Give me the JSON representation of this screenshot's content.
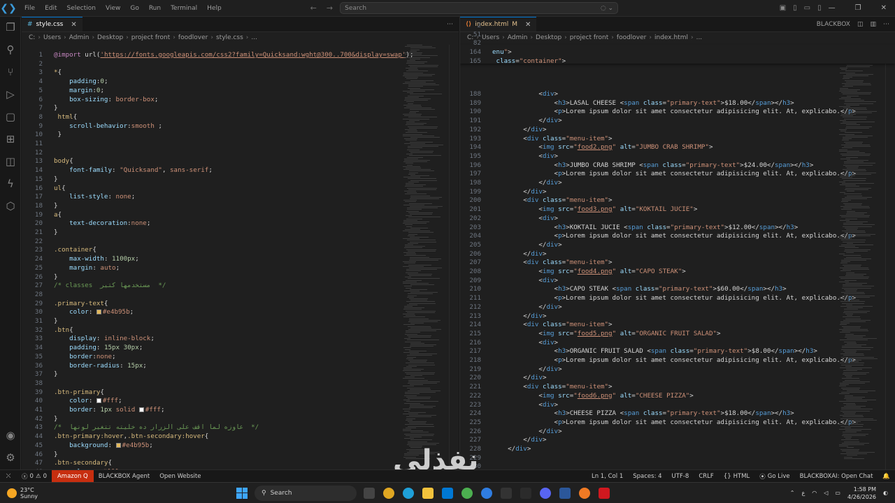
{
  "titlebar": {
    "menu": [
      "File",
      "Edit",
      "Selection",
      "View",
      "Go",
      "Run",
      "Terminal",
      "Help"
    ],
    "search_placeholder": "Search"
  },
  "left_editor": {
    "tab_label": "style.css",
    "breadcrumb": [
      "C:",
      "Users",
      "Admin",
      "Desktop",
      "project front",
      "foodlover",
      "style.css",
      "..."
    ],
    "lines": [
      {
        "n": "1",
        "html": "<span class='at'>@import</span> <span class='pu'>url(</span><span class='u'>'https://fonts.googleapis.com/css2?family=Quicksand:wght@300..700&display=swap'</span><span class='pu'>);</span>"
      },
      {
        "n": "2",
        "html": ""
      },
      {
        "n": "3",
        "html": "<span class='k'>*</span><span class='pu'>{</span>"
      },
      {
        "n": "4",
        "html": "    <span class='p'>padding</span><span class='pu'>:</span><span class='n'>0</span><span class='pu'>;</span>"
      },
      {
        "n": "5",
        "html": "    <span class='p'>margin</span><span class='pu'>:</span><span class='n'>0</span><span class='pu'>;</span>"
      },
      {
        "n": "6",
        "html": "    <span class='p'>box-sizing</span><span class='pu'>: </span><span class='v'>border-box</span><span class='pu'>;</span>"
      },
      {
        "n": "7",
        "html": "<span class='pu'>}</span>"
      },
      {
        "n": "8",
        "html": " <span class='k'>html</span><span class='pu'>{</span>"
      },
      {
        "n": "9",
        "html": "    <span class='p'>scroll-behavior</span><span class='pu'>:</span><span class='v'>smooth</span> <span class='pu'>;</span>"
      },
      {
        "n": "10",
        "html": " <span class='pu'>}</span>"
      },
      {
        "n": "11",
        "html": ""
      },
      {
        "n": "12",
        "html": ""
      },
      {
        "n": "13",
        "html": "<span class='k'>body</span><span class='pu'>{</span>"
      },
      {
        "n": "14",
        "html": "    <span class='p'>font-family</span><span class='pu'>: </span><span class='s'>\"Quicksand\"</span><span class='pu'>, </span><span class='v'>sans-serif</span><span class='pu'>;</span>"
      },
      {
        "n": "15",
        "html": "<span class='pu'>}</span>"
      },
      {
        "n": "16",
        "html": "<span class='k'>ul</span><span class='pu'>{</span>"
      },
      {
        "n": "17",
        "html": "    <span class='p'>list-style</span><span class='pu'>: </span><span class='v'>none</span><span class='pu'>;</span>"
      },
      {
        "n": "18",
        "html": "<span class='pu'>}</span>"
      },
      {
        "n": "19",
        "html": "<span class='k'>a</span><span class='pu'>{</span>"
      },
      {
        "n": "20",
        "html": "    <span class='p'>text-decoration</span><span class='pu'>:</span><span class='v'>none</span><span class='pu'>;</span>"
      },
      {
        "n": "21",
        "html": "<span class='pu'>}</span>"
      },
      {
        "n": "22",
        "html": ""
      },
      {
        "n": "23",
        "html": "<span class='k'>.container</span><span class='pu'>{</span>"
      },
      {
        "n": "24",
        "html": "    <span class='p'>max-width</span><span class='pu'>: </span><span class='n'>1100px</span><span class='pu'>;</span>"
      },
      {
        "n": "25",
        "html": "    <span class='p'>margin</span><span class='pu'>: </span><span class='v'>auto</span><span class='pu'>;</span>"
      },
      {
        "n": "26",
        "html": "<span class='pu'>}</span>"
      },
      {
        "n": "27",
        "html": "<span class='c'>/* classes  مستخدمها كتير  */</span>"
      },
      {
        "n": "28",
        "html": ""
      },
      {
        "n": "29",
        "html": "<span class='k'>.primary-text</span><span class='pu'>{</span>"
      },
      {
        "n": "30",
        "html": "    <span class='p'>color</span><span class='pu'>: </span><span class='sw' style='background:#e4b95b'></span><span class='v'>#e4b95b</span><span class='pu'>;</span>"
      },
      {
        "n": "31",
        "html": "<span class='pu'>}</span>"
      },
      {
        "n": "32",
        "html": "<span class='k'>.btn</span><span class='pu'>{</span>"
      },
      {
        "n": "33",
        "html": "    <span class='p'>display</span><span class='pu'>: </span><span class='v'>inline-block</span><span class='pu'>;</span>"
      },
      {
        "n": "34",
        "html": "    <span class='p'>padding</span><span class='pu'>: </span><span class='n'>15px 30px</span><span class='pu'>;</span>"
      },
      {
        "n": "35",
        "html": "    <span class='p'>border</span><span class='pu'>:</span><span class='v'>none</span><span class='pu'>;</span>"
      },
      {
        "n": "36",
        "html": "    <span class='p'>border-radius</span><span class='pu'>: </span><span class='n'>15px</span><span class='pu'>;</span>"
      },
      {
        "n": "37",
        "html": "<span class='pu'>}</span>"
      },
      {
        "n": "38",
        "html": ""
      },
      {
        "n": "39",
        "html": "<span class='k'>.btn-primary</span><span class='pu'>{</span>"
      },
      {
        "n": "40",
        "html": "    <span class='p'>color</span><span class='pu'>: </span><span class='sw' style='background:#ffffff'></span><span class='v'>#fff</span><span class='pu'>;</span>"
      },
      {
        "n": "41",
        "html": "    <span class='p'>border</span><span class='pu'>: </span><span class='n'>1px</span> <span class='v'>solid</span> <span class='sw' style='background:#ffffff'></span><span class='v'>#fff</span><span class='pu'>;</span>"
      },
      {
        "n": "42",
        "html": "<span class='pu'>}</span>"
      },
      {
        "n": "43",
        "html": "<span class='c'>/*  عاوزه لما اقف على الزرار ده خليته تتغير لونها  */</span>"
      },
      {
        "n": "44",
        "html": "<span class='k'>.btn-primary:hover</span><span class='pu'>,</span><span class='k'>.btn-secondary:hover</span><span class='pu'>{</span>"
      },
      {
        "n": "45",
        "html": "    <span class='p'>background</span><span class='pu'>: </span><span class='sw' style='background:#e4b95b'></span><span class='v'>#e4b95b</span><span class='pu'>;</span>"
      },
      {
        "n": "46",
        "html": "<span class='pu'>}</span>"
      },
      {
        "n": "47",
        "html": "<span class='k'>.btn-secondary</span><span class='pu'>{</span>"
      },
      {
        "n": "48",
        "html": "    <span class='p'>color</span><span class='pu'>: </span><span class='sw' style='background:#ffffff'></span><span class='v'>#fff</span><span class='pu'>;</span>"
      }
    ]
  },
  "right_editor": {
    "tab_label": "index.html",
    "tab_status": "M",
    "panel_label": "BLACKBOX",
    "breadcrumb": [
      "C:",
      "Users",
      "Admin",
      "Desktop",
      "project front",
      "foodlover",
      "index.html",
      "..."
    ],
    "sticky_lines": [
      {
        "n": "2",
        "html": ""
      },
      {
        "n": "51",
        "html": ""
      },
      {
        "n": "82",
        "html": ""
      },
      {
        "n": "164",
        "html": "<span class='a'>enu</span><span class='s'>\"</span><span class='pu'>&gt;</span>"
      },
      {
        "n": "165",
        "html": "<span class='a'> class</span><span class='pu'>=</span><span class='s'>\"container\"</span><span class='pu'>&gt;</span>"
      }
    ],
    "lines": [
      {
        "n": "188",
        "html": "            <span class='pu'>&lt;</span><span class='t'>div</span><span class='pu'>&gt;</span>"
      },
      {
        "n": "189",
        "html": "                <span class='pu'>&lt;</span><span class='t'>h3</span><span class='pu'>&gt;</span>LASAL CHEESE <span class='pu'>&lt;</span><span class='t'>span</span> <span class='a'>class</span><span class='pu'>=</span><span class='s'>\"primary-text\"</span><span class='pu'>&gt;</span>$18.00<span class='pu'>&lt;/</span><span class='t'>span</span><span class='pu'>&gt;&lt;/</span><span class='t'>h3</span><span class='pu'>&gt;</span>"
      },
      {
        "n": "190",
        "html": "                <span class='pu'>&lt;</span><span class='t'>p</span><span class='pu'>&gt;</span>Lorem ipsum dolor sit amet consectetur adipisicing elit. At, explicabo.<span class='pu'>&lt;/</span><span class='t'>p</span><span class='pu'>&gt;</span>"
      },
      {
        "n": "191",
        "html": "            <span class='pu'>&lt;/</span><span class='t'>div</span><span class='pu'>&gt;</span>"
      },
      {
        "n": "192",
        "html": "        <span class='pu'>&lt;/</span><span class='t'>div</span><span class='pu'>&gt;</span>"
      },
      {
        "n": "193",
        "html": "        <span class='pu'>&lt;</span><span class='t'>div</span> <span class='a'>class</span><span class='pu'>=</span><span class='s'>\"menu-item\"</span><span class='pu'>&gt;</span>"
      },
      {
        "n": "194",
        "html": "            <span class='pu'>&lt;</span><span class='t'>img</span> <span class='a'>src</span><span class='pu'>=</span><span class='s'>\"<u>food2.png</u>\"</span> <span class='a'>alt</span><span class='pu'>=</span><span class='s'>\"JUMBO CRAB SHRIMP\"</span><span class='pu'>&gt;</span>"
      },
      {
        "n": "195",
        "html": "            <span class='pu'>&lt;</span><span class='t'>div</span><span class='pu'>&gt;</span>"
      },
      {
        "n": "196",
        "html": "                <span class='pu'>&lt;</span><span class='t'>h3</span><span class='pu'>&gt;</span>JUMBO CRAB SHRIMP <span class='pu'>&lt;</span><span class='t'>span</span> <span class='a'>class</span><span class='pu'>=</span><span class='s'>\"primary-text\"</span><span class='pu'>&gt;</span>$24.00<span class='pu'>&lt;/</span><span class='t'>span</span><span class='pu'>&gt;&lt;/</span><span class='t'>h3</span><span class='pu'>&gt;</span>"
      },
      {
        "n": "197",
        "html": "                <span class='pu'>&lt;</span><span class='t'>p</span><span class='pu'>&gt;</span>Lorem ipsum dolor sit amet consectetur adipisicing elit. At, explicabo.<span class='pu'>&lt;/</span><span class='t'>p</span><span class='pu'>&gt;</span>"
      },
      {
        "n": "198",
        "html": "            <span class='pu'>&lt;/</span><span class='t'>div</span><span class='pu'>&gt;</span>"
      },
      {
        "n": "199",
        "html": "        <span class='pu'>&lt;/</span><span class='t'>div</span><span class='pu'>&gt;</span>"
      },
      {
        "n": "200",
        "html": "        <span class='pu'>&lt;</span><span class='t'>div</span> <span class='a'>class</span><span class='pu'>=</span><span class='s'>\"menu-item\"</span><span class='pu'>&gt;</span>"
      },
      {
        "n": "201",
        "html": "            <span class='pu'>&lt;</span><span class='t'>img</span> <span class='a'>src</span><span class='pu'>=</span><span class='s'>\"<u>food3.png</u>\"</span> <span class='a'>alt</span><span class='pu'>=</span><span class='s'>\"KOKTAIL JUCIE\"</span><span class='pu'>&gt;</span>"
      },
      {
        "n": "202",
        "html": "            <span class='pu'>&lt;</span><span class='t'>div</span><span class='pu'>&gt;</span>"
      },
      {
        "n": "203",
        "html": "                <span class='pu'>&lt;</span><span class='t'>h3</span><span class='pu'>&gt;</span>KOKTAIL JUCIE <span class='pu'>&lt;</span><span class='t'>span</span> <span class='a'>class</span><span class='pu'>=</span><span class='s'>\"primary-text\"</span><span class='pu'>&gt;</span>$12.00<span class='pu'>&lt;/</span><span class='t'>span</span><span class='pu'>&gt;&lt;/</span><span class='t'>h3</span><span class='pu'>&gt;</span>"
      },
      {
        "n": "204",
        "html": "                <span class='pu'>&lt;</span><span class='t'>p</span><span class='pu'>&gt;</span>Lorem ipsum dolor sit amet consectetur adipisicing elit. At, explicabo.<span class='pu'>&lt;/</span><span class='t'>p</span><span class='pu'>&gt;</span>"
      },
      {
        "n": "205",
        "html": "            <span class='pu'>&lt;/</span><span class='t'>div</span><span class='pu'>&gt;</span>"
      },
      {
        "n": "206",
        "html": "        <span class='pu'>&lt;/</span><span class='t'>div</span><span class='pu'>&gt;</span>"
      },
      {
        "n": "207",
        "html": "        <span class='pu'>&lt;</span><span class='t'>div</span> <span class='a'>class</span><span class='pu'>=</span><span class='s'>\"menu-item\"</span><span class='pu'>&gt;</span>"
      },
      {
        "n": "208",
        "html": "            <span class='pu'>&lt;</span><span class='t'>img</span> <span class='a'>src</span><span class='pu'>=</span><span class='s'>\"<u>food4.png</u>\"</span> <span class='a'>alt</span><span class='pu'>=</span><span class='s'>\"CAPO STEAK\"</span><span class='pu'>&gt;</span>"
      },
      {
        "n": "209",
        "html": "            <span class='pu'>&lt;</span><span class='t'>div</span><span class='pu'>&gt;</span>"
      },
      {
        "n": "210",
        "html": "                <span class='pu'>&lt;</span><span class='t'>h3</span><span class='pu'>&gt;</span>CAPO STEAK <span class='pu'>&lt;</span><span class='t'>span</span> <span class='a'>class</span><span class='pu'>=</span><span class='s'>\"primary-text\"</span><span class='pu'>&gt;</span>$60.00<span class='pu'>&lt;/</span><span class='t'>span</span><span class='pu'>&gt;&lt;/</span><span class='t'>h3</span><span class='pu'>&gt;</span>"
      },
      {
        "n": "211",
        "html": "                <span class='pu'>&lt;</span><span class='t'>p</span><span class='pu'>&gt;</span>Lorem ipsum dolor sit amet consectetur adipisicing elit. At, explicabo.<span class='pu'>&lt;/</span><span class='t'>p</span><span class='pu'>&gt;</span>"
      },
      {
        "n": "212",
        "html": "            <span class='pu'>&lt;/</span><span class='t'>div</span><span class='pu'>&gt;</span>"
      },
      {
        "n": "213",
        "html": "        <span class='pu'>&lt;/</span><span class='t'>div</span><span class='pu'>&gt;</span>"
      },
      {
        "n": "214",
        "html": "        <span class='pu'>&lt;</span><span class='t'>div</span> <span class='a'>class</span><span class='pu'>=</span><span class='s'>\"menu-item\"</span><span class='pu'>&gt;</span>"
      },
      {
        "n": "215",
        "html": "            <span class='pu'>&lt;</span><span class='t'>img</span> <span class='a'>src</span><span class='pu'>=</span><span class='s'>\"<u>food5.png</u>\"</span> <span class='a'>alt</span><span class='pu'>=</span><span class='s'>\"ORGANIC FRUIT SALAD\"</span><span class='pu'>&gt;</span>"
      },
      {
        "n": "216",
        "html": "            <span class='pu'>&lt;</span><span class='t'>div</span><span class='pu'>&gt;</span>"
      },
      {
        "n": "217",
        "html": "                <span class='pu'>&lt;</span><span class='t'>h3</span><span class='pu'>&gt;</span>ORGANIC FRUIT SALAD <span class='pu'>&lt;</span><span class='t'>span</span> <span class='a'>class</span><span class='pu'>=</span><span class='s'>\"primary-text\"</span><span class='pu'>&gt;</span>$8.00<span class='pu'>&lt;/</span><span class='t'>span</span><span class='pu'>&gt;&lt;/</span><span class='t'>h3</span><span class='pu'>&gt;</span>"
      },
      {
        "n": "218",
        "html": "                <span class='pu'>&lt;</span><span class='t'>p</span><span class='pu'>&gt;</span>Lorem ipsum dolor sit amet consectetur adipisicing elit. At, explicabo.<span class='pu'>&lt;/</span><span class='t'>p</span><span class='pu'>&gt;</span>"
      },
      {
        "n": "219",
        "html": "            <span class='pu'>&lt;/</span><span class='t'>div</span><span class='pu'>&gt;</span>"
      },
      {
        "n": "220",
        "html": "        <span class='pu'>&lt;/</span><span class='t'>div</span><span class='pu'>&gt;</span>"
      },
      {
        "n": "221",
        "html": "        <span class='pu'>&lt;</span><span class='t'>div</span> <span class='a'>class</span><span class='pu'>=</span><span class='s'>\"menu-item\"</span><span class='pu'>&gt;</span>"
      },
      {
        "n": "222",
        "html": "            <span class='pu'>&lt;</span><span class='t'>img</span> <span class='a'>src</span><span class='pu'>=</span><span class='s'>\"<u>food6.png</u>\"</span> <span class='a'>alt</span><span class='pu'>=</span><span class='s'>\"CHEESE PIZZA\"</span><span class='pu'>&gt;</span>"
      },
      {
        "n": "223",
        "html": "            <span class='pu'>&lt;</span><span class='t'>div</span><span class='pu'>&gt;</span>"
      },
      {
        "n": "224",
        "html": "                <span class='pu'>&lt;</span><span class='t'>h3</span><span class='pu'>&gt;</span>CHEESE PIZZA <span class='pu'>&lt;</span><span class='t'>span</span> <span class='a'>class</span><span class='pu'>=</span><span class='s'>\"primary-text\"</span><span class='pu'>&gt;</span>$18.00<span class='pu'>&lt;/</span><span class='t'>span</span><span class='pu'>&gt;&lt;/</span><span class='t'>h3</span><span class='pu'>&gt;</span>"
      },
      {
        "n": "225",
        "html": "                <span class='pu'>&lt;</span><span class='t'>p</span><span class='pu'>&gt;</span>Lorem ipsum dolor sit amet consectetur adipisicing elit. At, explicabo.<span class='pu'>&lt;/</span><span class='t'>p</span><span class='pu'>&gt;</span>"
      },
      {
        "n": "226",
        "html": "            <span class='pu'>&lt;/</span><span class='t'>div</span><span class='pu'>&gt;</span>"
      },
      {
        "n": "227",
        "html": "        <span class='pu'>&lt;/</span><span class='t'>div</span><span class='pu'>&gt;</span>"
      },
      {
        "n": "228",
        "html": "    <span class='pu'>&lt;/</span><span class='t'>div</span><span class='pu'>&gt;</span>"
      },
      {
        "n": "229",
        "html": ""
      },
      {
        "n": "230",
        "html": ""
      }
    ]
  },
  "watermark": "نفذلي",
  "statusbar": {
    "errors": "0",
    "warnings": "0",
    "amazon_q": "Amazon Q",
    "blackbox_agent": "BLACKBOX Agent",
    "open_website": "Open Website",
    "position": "Ln 1, Col 1",
    "spaces": "Spaces: 4",
    "encoding": "UTF-8",
    "eol": "CRLF",
    "language": "HTML",
    "go_live": "Go Live",
    "blackbox_chat": "BLACKBOXAI: Open Chat"
  },
  "taskbar": {
    "temperature": "23°C",
    "condition": "Sunny",
    "search_label": "Search",
    "time": "1:58 PM",
    "date": "4/26/2026"
  },
  "colors": {
    "accent": "#0078d4",
    "amazon_q": "#c72e0f",
    "primary_text": "#e4b95b"
  }
}
